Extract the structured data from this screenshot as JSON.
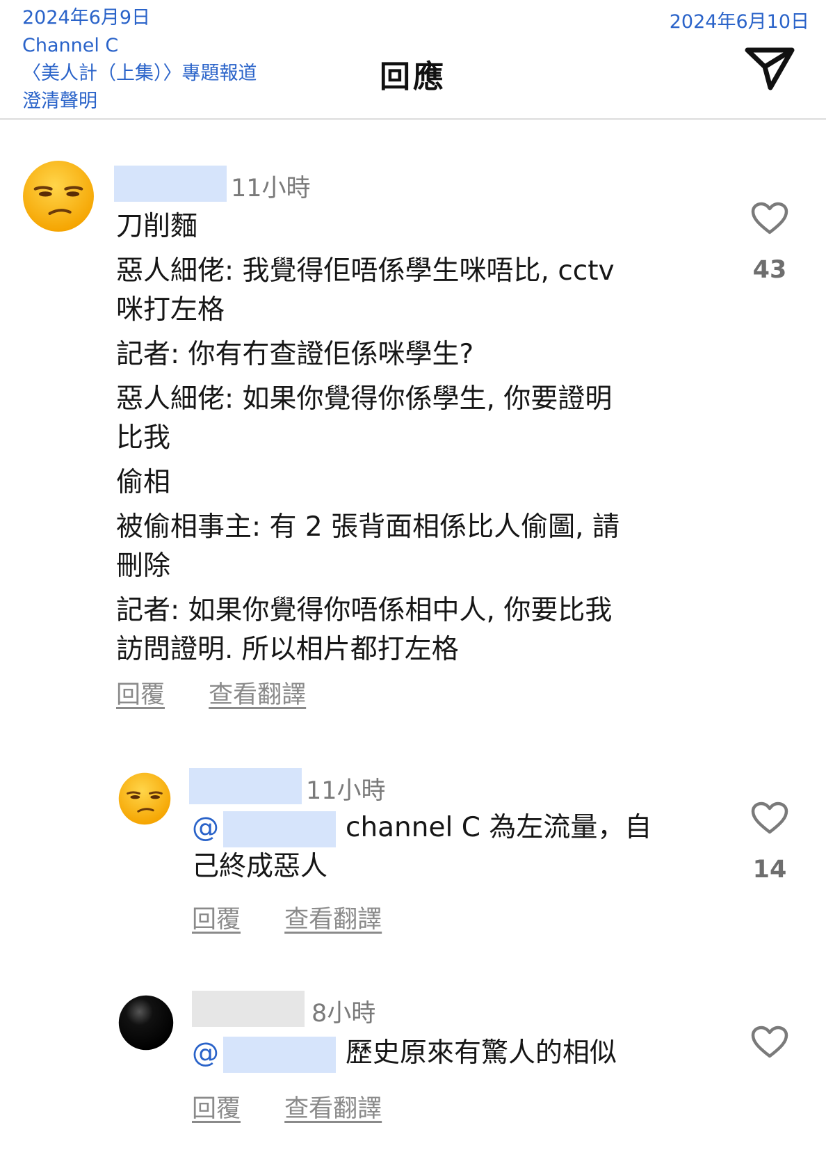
{
  "header": {
    "left_note": [
      "2024年6月9日",
      "Channel C",
      "〈美人計（上集）〉專題報道",
      "澄清聲明"
    ],
    "right_note": "2024年6月10日",
    "title": "回應",
    "send_icon": "send-icon"
  },
  "comments": [
    {
      "time": "11小時",
      "lines": [
        "刀削麵",
        "惡人細佬: 我覺得佢唔係學生咪唔比, cctv",
        "咪打左格",
        "記者: 你有冇查證佢係咪學生?",
        "惡人細佬: 如果你覺得你係學生, 你要證明",
        "比我",
        "偷相",
        "被偷相事主: 有 2 張背面相係比人偷圖, 請",
        "刪除",
        "記者: 如果你覺得你唔係相中人, 你要比我",
        "訪問證明. 所以相片都打左格"
      ],
      "likes": "43",
      "reply": "回覆",
      "translate": "查看翻譯"
    },
    {
      "time": "11小時",
      "mention_at": "@",
      "line1": "channel C 為左流量，自",
      "line2": "己終成惡人",
      "likes": "14",
      "reply": "回覆",
      "translate": "查看翻譯"
    },
    {
      "time": "8小時",
      "mention_at": "@",
      "line1": "歷史原來有驚人的相似",
      "reply": "回覆",
      "translate": "查看翻譯"
    }
  ],
  "colors": {
    "accent": "#2a63c9",
    "mask_blue": "#d6e4fb",
    "mask_grey": "#e6e6e6",
    "muted": "#8a8a8a"
  }
}
